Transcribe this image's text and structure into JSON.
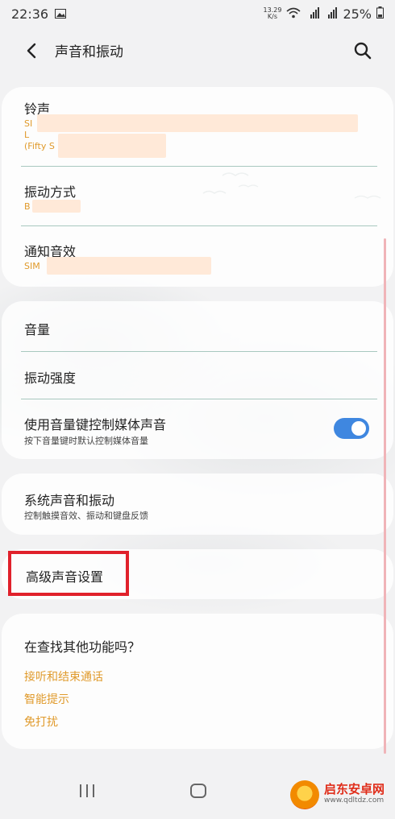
{
  "status_bar": {
    "time": "22:36",
    "net_speed_value": "13.29",
    "net_speed_unit": "K/s",
    "battery": "25%"
  },
  "app_bar": {
    "title": "声音和振动",
    "back_icon": "chevron-left-icon",
    "search_icon": "search-icon"
  },
  "card1": {
    "ringtone": {
      "title": "铃声",
      "sub_line1": "SI",
      "sub_line2": "L",
      "sub_line3": "(Fifty S"
    },
    "vibration_pattern": {
      "title": "振动方式",
      "sub": "B"
    },
    "notification_sound": {
      "title": "通知音效",
      "sub": "SIM"
    }
  },
  "card2": {
    "volume": {
      "title": "音量"
    },
    "vibration_intensity": {
      "title": "振动强度"
    },
    "media_volume_key": {
      "title": "使用音量键控制媒体声音",
      "sub": "按下音量键时默认控制媒体音量",
      "toggle_on": true
    }
  },
  "card3": {
    "system_sound": {
      "title": "系统声音和振动",
      "sub": "控制触摸音效、振动和键盘反馈"
    }
  },
  "card4": {
    "advanced_sound": {
      "title": "高级声音设置"
    }
  },
  "card5": {
    "heading": "在查找其他功能吗？",
    "links": [
      "接听和结束通话",
      "智能提示",
      "免打扰"
    ]
  },
  "watermark": {
    "main": "启东安卓网",
    "url": "www.qdltdz.com"
  },
  "colors": {
    "accent_orange": "#e09a2b",
    "toggle_blue": "#3f87e0",
    "highlight_red": "#e0212b"
  }
}
